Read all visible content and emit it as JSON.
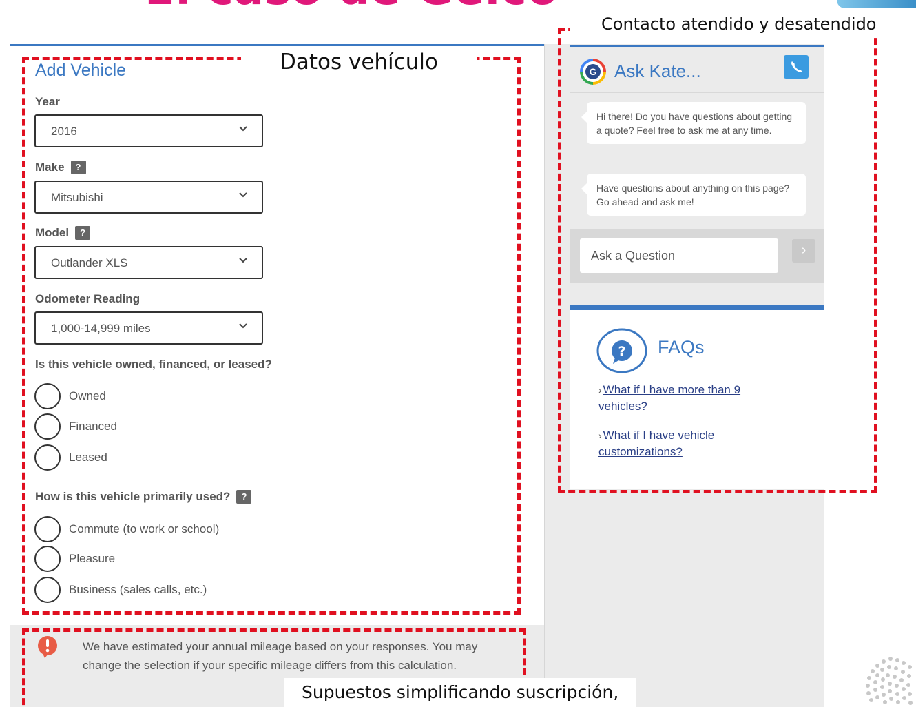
{
  "slide": {
    "title": "El caso de Geico"
  },
  "annotations": {
    "vehicle_data": "Datos vehículo",
    "contact": "Contacto atendido y desatendido",
    "assumptions": "Supuestos simplificando suscripción,"
  },
  "form": {
    "title": "Add Vehicle",
    "year": {
      "label": "Year",
      "value": "2016"
    },
    "make": {
      "label": "Make",
      "help": "?",
      "value": "Mitsubishi"
    },
    "model": {
      "label": "Model",
      "help": "?",
      "value": "Outlander XLS"
    },
    "odometer": {
      "label": "Odometer Reading",
      "value": "1,000-14,999 miles"
    },
    "ownership": {
      "question": "Is this vehicle owned, financed, or leased?",
      "options": [
        "Owned",
        "Financed",
        "Leased"
      ]
    },
    "usage": {
      "question": "How is this vehicle primarily used?",
      "help": "?",
      "options": [
        "Commute (to work or school)",
        "Pleasure",
        "Business (sales calls, etc.)"
      ]
    }
  },
  "alert": {
    "text": "We have estimated your annual mileage based on your responses. You may change the selection if your specific mileage differs from this calculation."
  },
  "kate": {
    "logo_letter": "G",
    "title": "Ask Kate...",
    "messages": [
      "Hi there! Do you have questions about getting a quote? Feel free to ask me at any time.",
      "Have questions about anything on this page? Go ahead and ask me!"
    ],
    "input_placeholder": "Ask a Question",
    "send": "›"
  },
  "faqs": {
    "title": "FAQs",
    "links": [
      "What if I have more than 9 vehicles?",
      "What if I have vehicle customizations?"
    ]
  },
  "colors": {
    "accent": "#3b78c2",
    "annotation": "#e01020",
    "title_pink": "#e0187a"
  },
  "icons": {
    "chevron": "chevron-down-icon",
    "phone": "phone-icon",
    "question": "question-circle-icon",
    "alert": "alert-exclamation-icon"
  }
}
